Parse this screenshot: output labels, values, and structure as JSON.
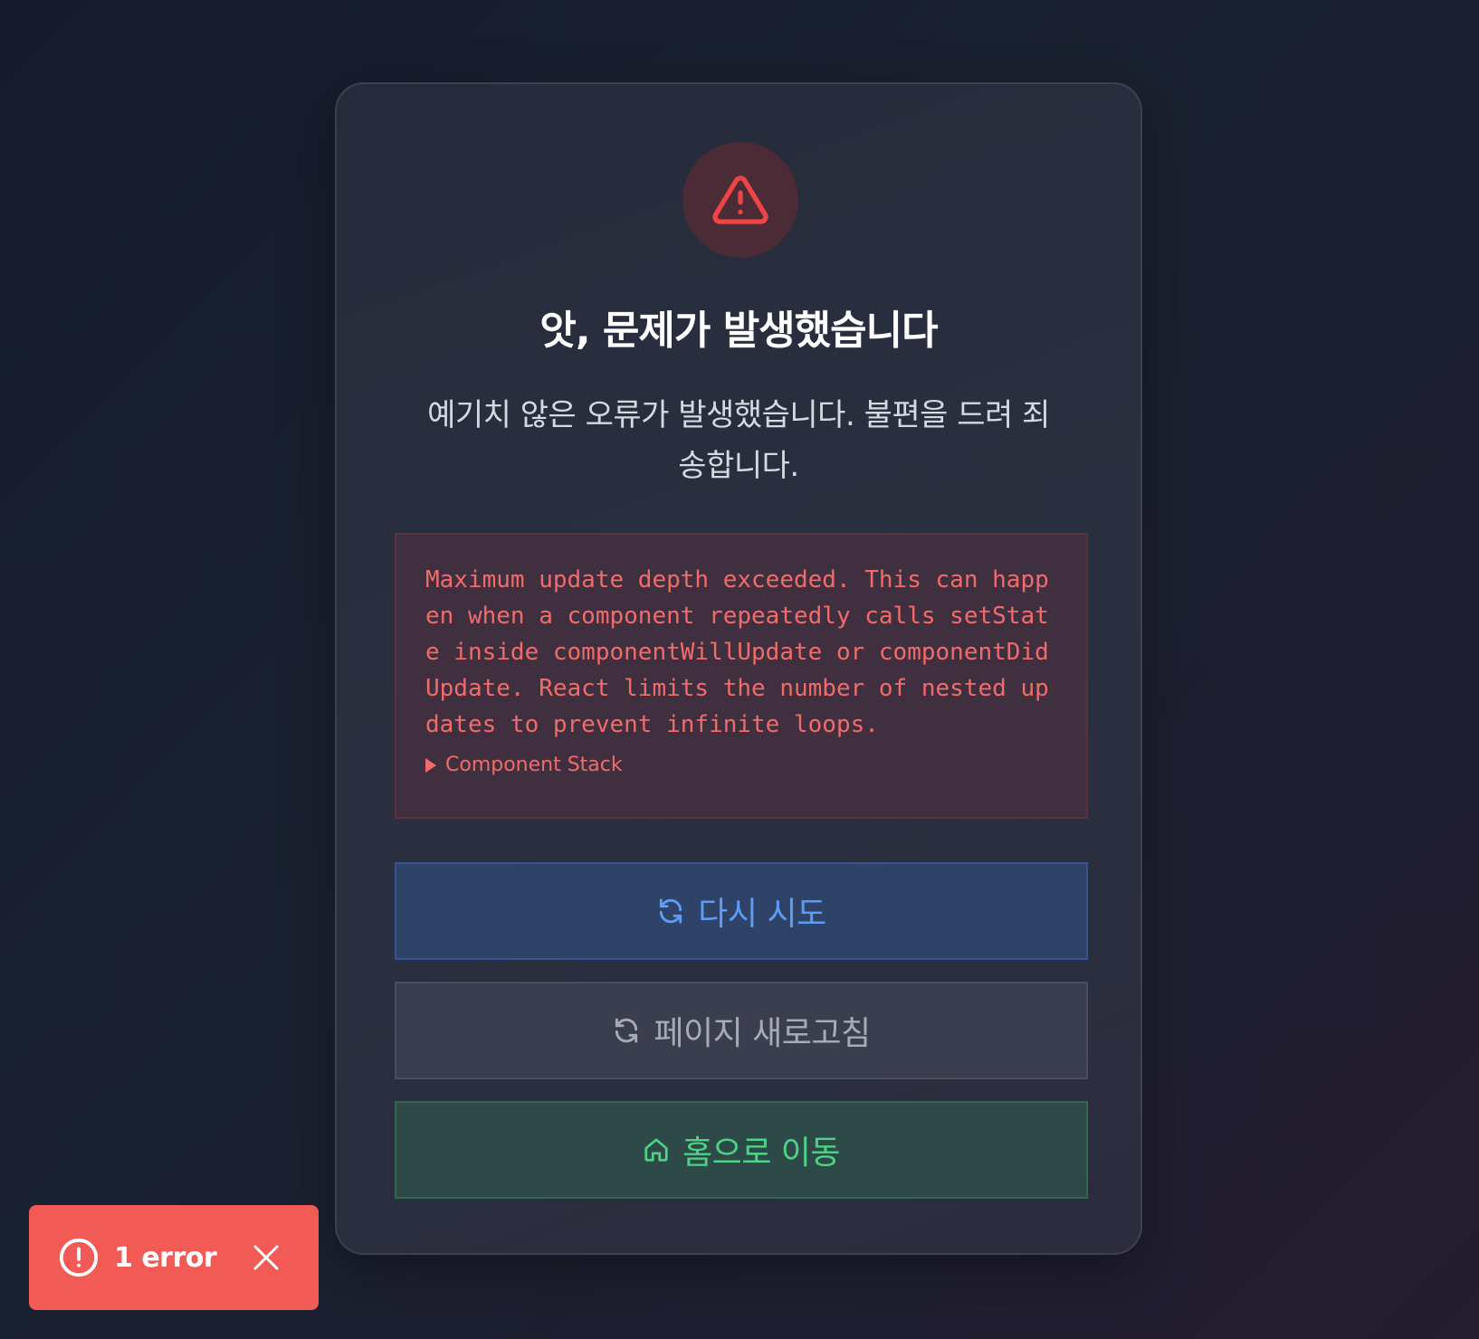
{
  "card": {
    "title": "앗, 문제가 발생했습니다",
    "description": "예기치 않은 오류가 발생했습니다. 불편을 드려 죄송합니다.",
    "error_message": "Maximum update depth exceeded. This can happen when a component repeatedly calls setState inside componentWillUpdate or componentDidUpdate. React limits the number of nested updates to prevent infinite loops.",
    "stack_toggle_label": "Component Stack",
    "icon": "warning-triangle-icon"
  },
  "buttons": {
    "retry_label": "다시 시도",
    "reload_label": "페이지 새로고침",
    "home_label": "홈으로 이동"
  },
  "toast": {
    "label": "1 error"
  },
  "colors": {
    "danger": "#f26b6b",
    "primary": "#5d9cf5",
    "success": "#4dd286",
    "toast_bg": "#f25a56"
  }
}
